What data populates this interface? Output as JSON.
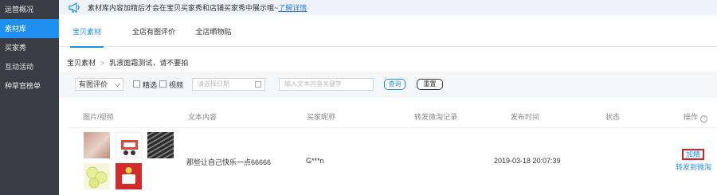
{
  "sidebar": {
    "items": [
      {
        "label": "运营概况",
        "active": false
      },
      {
        "label": "素材库",
        "active": true
      },
      {
        "label": "买家秀",
        "active": false
      },
      {
        "label": "互动活动",
        "active": false
      },
      {
        "label": "种草官榜单",
        "active": false
      }
    ]
  },
  "notice": {
    "icon": "megaphone-icon",
    "text": "素材库内容加精后才会在宝贝买家秀和店铺买家秀中展示哦~",
    "link": "了解详情"
  },
  "tabs": [
    {
      "label": "宝贝素材",
      "active": true
    },
    {
      "label": "全店有图评价",
      "active": false
    },
    {
      "label": "全店晒物贴",
      "active": false
    }
  ],
  "breadcrumb": {
    "root": "宝贝素材",
    "separator": ">",
    "current": "乳液面霜测试，请不要拍"
  },
  "filters": {
    "type_select": "有图评价",
    "checkbox_featured": "精选",
    "checkbox_video": "视频",
    "date_placeholder": "请选择日期",
    "keyword_placeholder": "输入文本内容关键字",
    "search_button": "查询",
    "reset_button": "重置"
  },
  "table": {
    "headers": [
      "图片/视频",
      "文本内容",
      "买家昵称",
      "转发微淘记录",
      "发布时间",
      "状态",
      "操作"
    ],
    "help_icon": "?",
    "rows": [
      {
        "thumbnails": 5,
        "content": "那些让自己快乐一点66666",
        "nickname": "G***n",
        "forward_record": "",
        "publish_time": "2019-03-18 20:07:39",
        "status": "",
        "actions": {
          "feature": "加精",
          "forward": "转发到微淘"
        }
      }
    ]
  },
  "colors": {
    "accent": "#1f8ff0",
    "sidebar_bg": "#3a3d45",
    "highlight_border": "#e02020"
  }
}
